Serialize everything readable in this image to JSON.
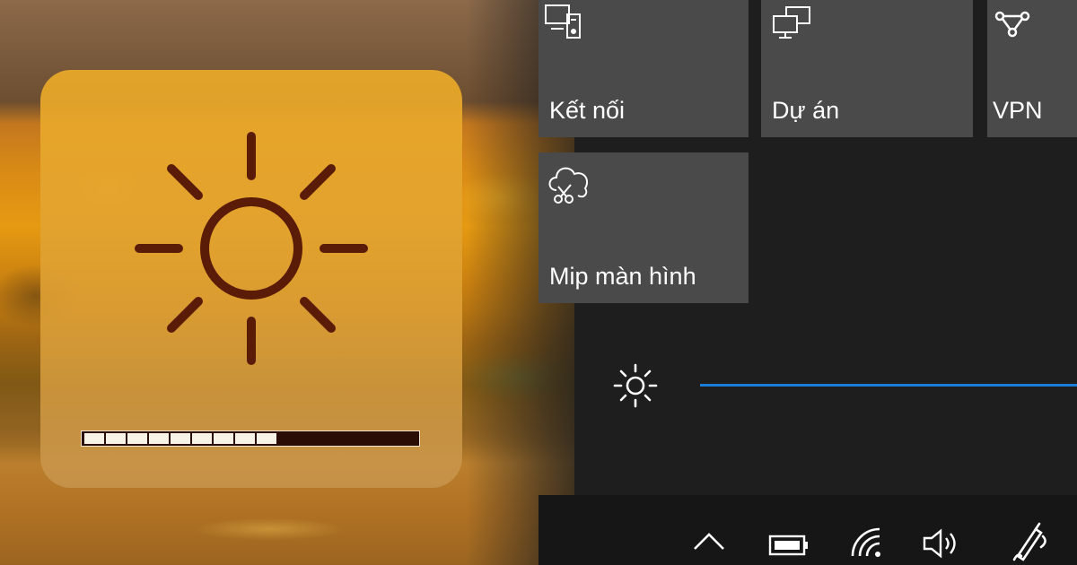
{
  "mac_hud": {
    "icon": "sun-icon",
    "brightness_segments_filled": 9,
    "brightness_segments_total": 16
  },
  "action_center": {
    "tiles": [
      {
        "label": "Kết nối",
        "icon": "connect-icon"
      },
      {
        "label": "Dự án",
        "icon": "project-icon"
      },
      {
        "label": "VPN",
        "icon": "vpn-icon"
      },
      {
        "label": "Mip màn hình",
        "icon": "snip-icon"
      }
    ],
    "brightness": {
      "icon": "brightness-icon"
    }
  },
  "taskbar": {
    "icons": [
      "chevron-up-icon",
      "battery-icon",
      "wifi-icon",
      "volume-icon",
      "pen-icon"
    ]
  },
  "colors": {
    "tile_bg": "#4a4a4a",
    "slider_accent": "#1a7ed8",
    "hud_glyph": "#5a1c06"
  }
}
